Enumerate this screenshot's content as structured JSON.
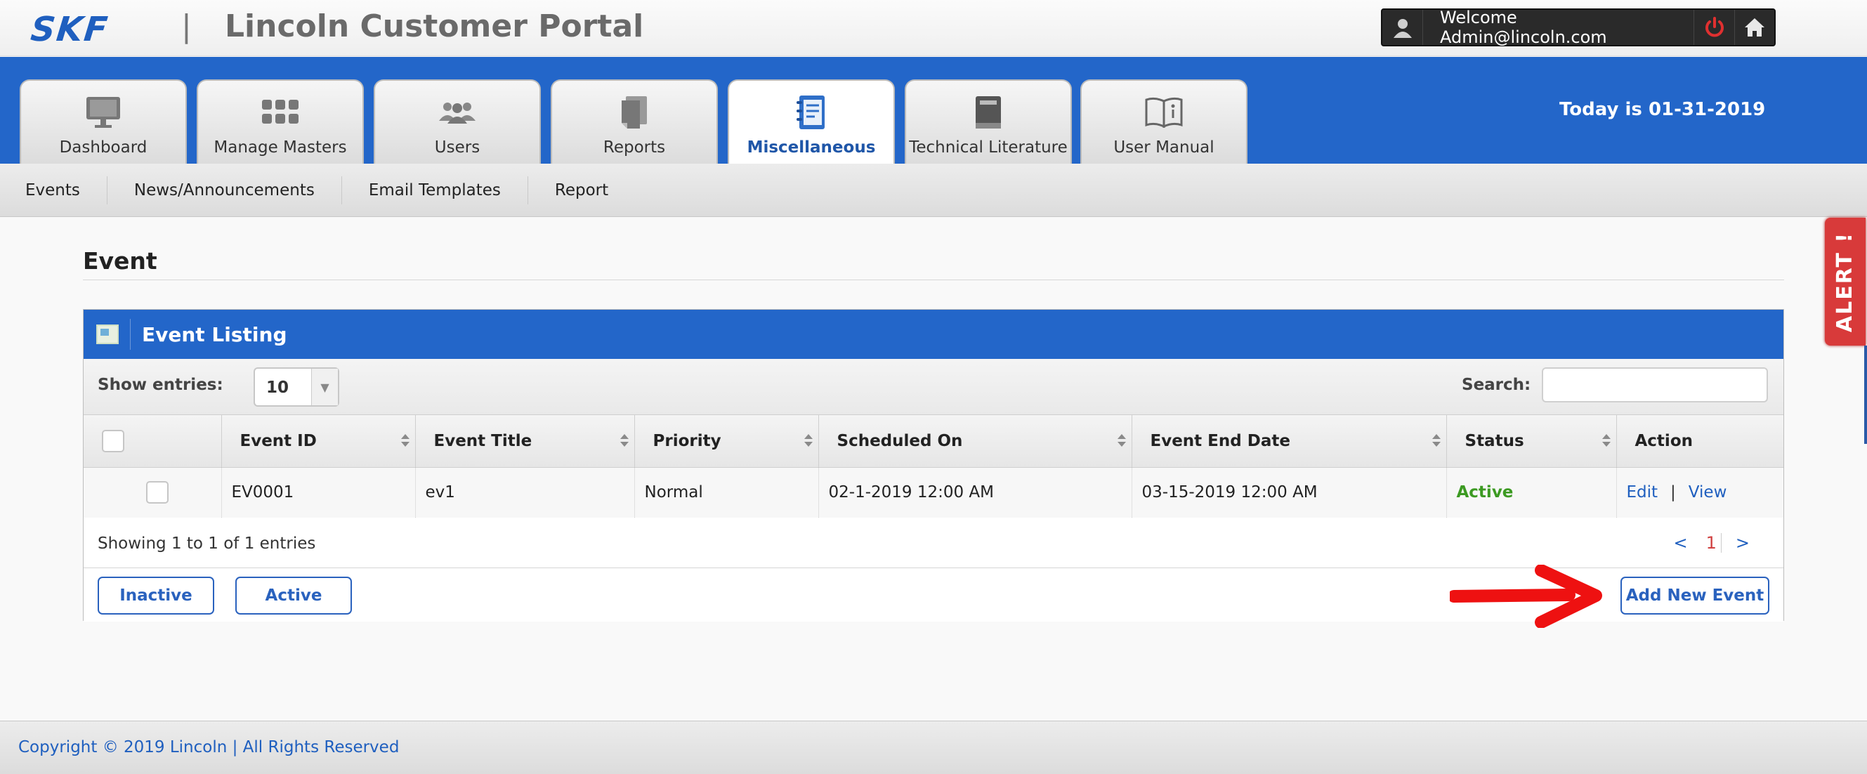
{
  "header": {
    "logo": "SKF",
    "separator": "|",
    "title": "Lincoln Customer Portal",
    "welcome": "Welcome Admin@lincoln.com",
    "icons": [
      "user-icon",
      "power-icon",
      "home-icon"
    ]
  },
  "nav": {
    "tabs": [
      {
        "label": "Dashboard",
        "icon": "monitor-icon"
      },
      {
        "label": "Manage Masters",
        "icon": "grid-icon"
      },
      {
        "label": "Users",
        "icon": "users-icon"
      },
      {
        "label": "Reports",
        "icon": "reports-icon"
      },
      {
        "label": "Miscellaneous",
        "icon": "notebook-icon",
        "active": true
      },
      {
        "label": "Technical Literature",
        "icon": "book-icon"
      },
      {
        "label": "User Manual",
        "icon": "manual-icon"
      }
    ],
    "date": "Today is 01-31-2019"
  },
  "subnav": {
    "items": [
      "Events",
      "News/Announcements",
      "Email Templates",
      "Report"
    ]
  },
  "alert": "ALERT !",
  "page": {
    "heading": "Event",
    "panel_title": "Event Listing",
    "show_entries_label": "Show entries:",
    "show_entries_value": "10",
    "search_label": "Search:",
    "search_value": "",
    "columns": [
      "Event ID",
      "Event Title",
      "Priority",
      "Scheduled On",
      "Event End Date",
      "Status",
      "Action"
    ],
    "rows": [
      {
        "event_id": "EV0001",
        "title": "ev1",
        "priority": "Normal",
        "scheduled_on": "02-1-2019 12:00 AM",
        "end_date": "03-15-2019 12:00 AM",
        "status": "Active",
        "action_edit": "Edit",
        "action_sep": "|",
        "action_view": "View"
      }
    ],
    "info": "Showing 1 to 1 of 1 entries",
    "pager": {
      "prev": "<",
      "current": "1",
      "next": ">"
    },
    "buttons": {
      "inactive": "Inactive",
      "active": "Active",
      "add": "Add New Event"
    }
  },
  "footer": {
    "text": "Copyright © 2019 Lincoln | All Rights Reserved"
  },
  "colors": {
    "brand_blue": "#2366c9",
    "status_active": "#3c9a22",
    "alert_red": "#d83a3a",
    "annotation_arrow": "#ee1111"
  }
}
